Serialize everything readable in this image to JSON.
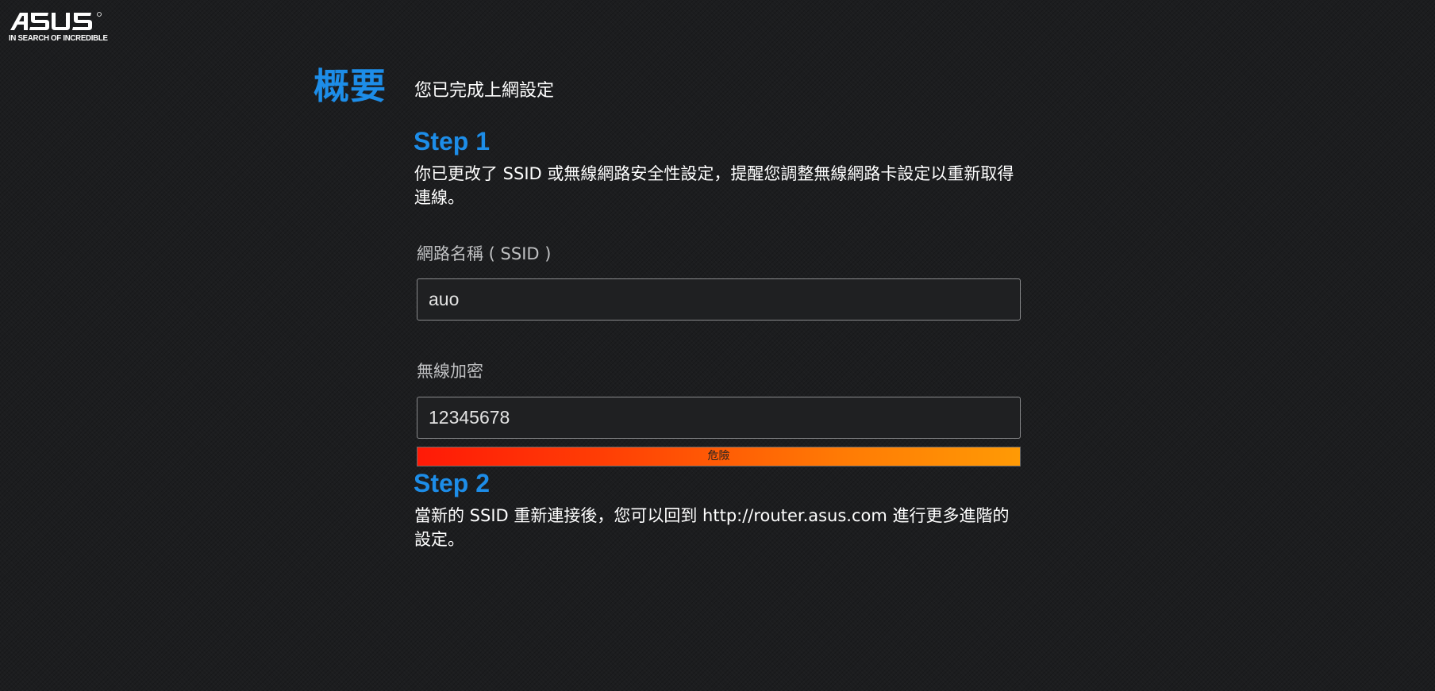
{
  "logo": {
    "brand": "ASUS",
    "tagline": "IN SEARCH OF INCREDIBLE"
  },
  "header": {
    "title": "概要",
    "subtitle": "您已完成上網設定"
  },
  "step1": {
    "heading": "Step 1",
    "description": "你已更改了 SSID 或無線網路安全性設定，提醒您調整無線網路卡設定以重新取得連線。",
    "ssid": {
      "label": "網路名稱 ( SSID )",
      "value": "auo"
    },
    "wireless_key": {
      "label": "無線加密",
      "value": "12345678"
    },
    "strength": {
      "label": "危險",
      "level": 1.0,
      "colors": [
        "#ff1a07",
        "#ff9a05"
      ]
    }
  },
  "step2": {
    "heading": "Step 2",
    "description": "當新的 SSID 重新連接後，您可以回到 http://router.asus.com 進行更多進階的設定。"
  },
  "theme": {
    "accent": "#1d8de8",
    "background": "#1c1d1f"
  }
}
